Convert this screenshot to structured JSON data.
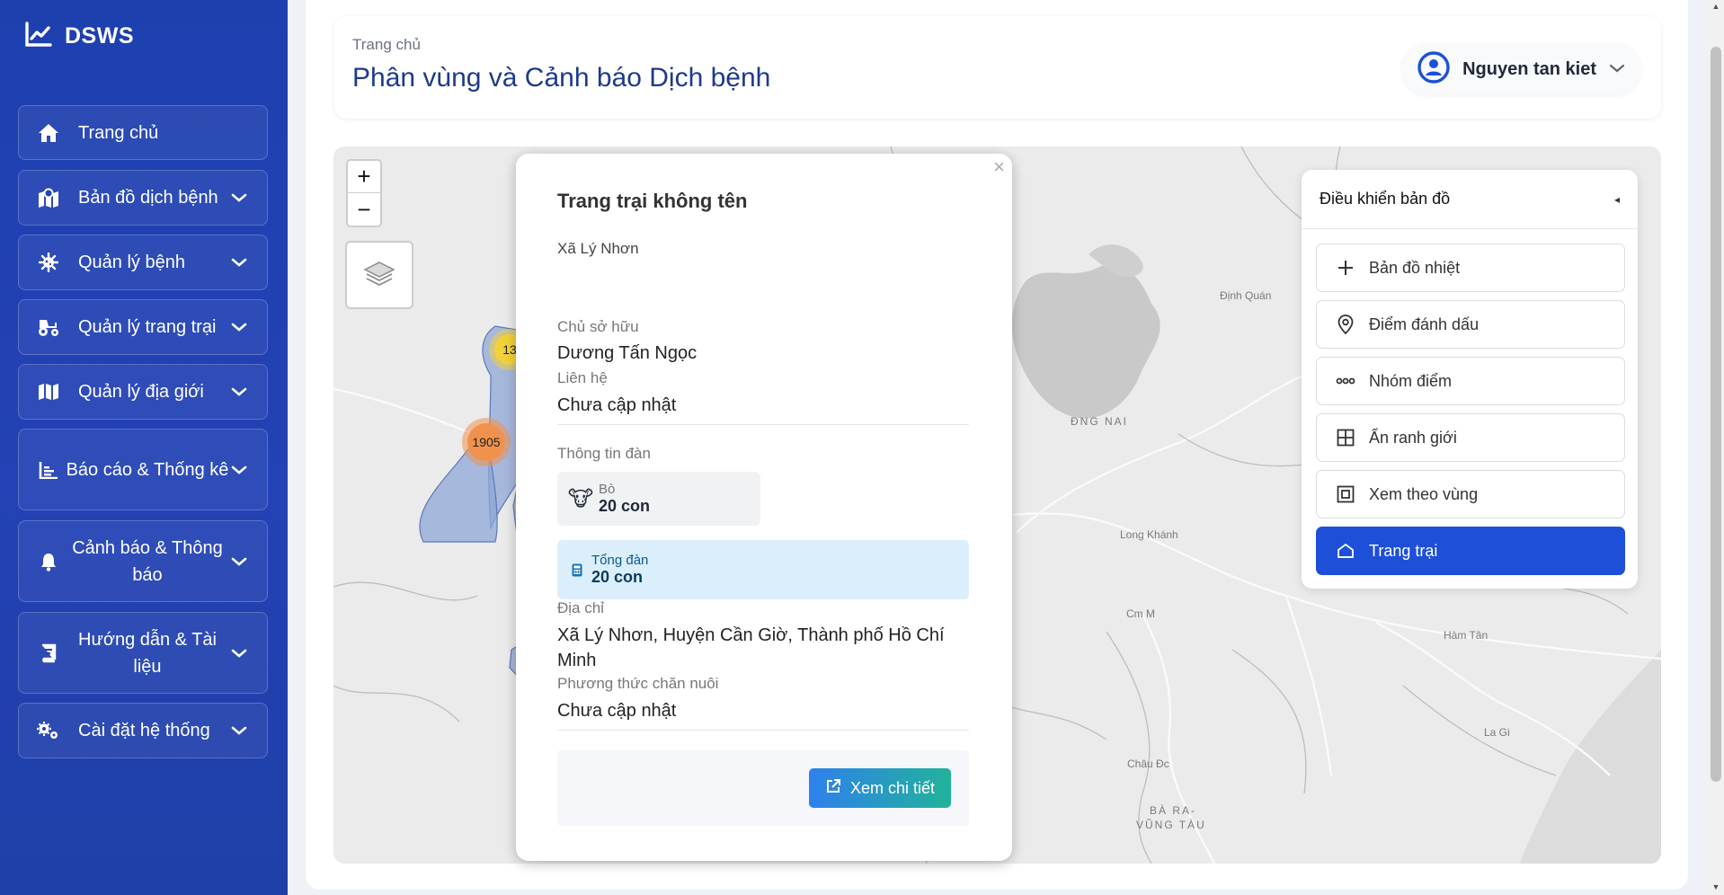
{
  "app": {
    "name": "DSWS"
  },
  "sidebar": {
    "items": [
      {
        "label": "Trang chủ",
        "icon": "home-icon"
      },
      {
        "label": "Bản đồ dịch bệnh",
        "icon": "map-marker-icon"
      },
      {
        "label": "Quản lý bệnh",
        "icon": "virus-icon"
      },
      {
        "label": "Quản lý trang trại",
        "icon": "tractor-icon"
      },
      {
        "label": "Quản lý địa giới",
        "icon": "map-icon"
      },
      {
        "label": "Báo cáo & Thống kê",
        "icon": "chart-icon"
      },
      {
        "label": "Cảnh báo & Thông báo",
        "icon": "bell-icon"
      },
      {
        "label": "Hướng dẫn & Tài liệu",
        "icon": "book-icon"
      },
      {
        "label": "Cài đặt hệ thống",
        "icon": "gears-icon"
      }
    ]
  },
  "header": {
    "breadcrumb": "Trang chủ",
    "title": "Phân vùng và Cảnh báo Dịch bệnh",
    "user_name": "Nguyen tan kiet"
  },
  "map": {
    "zoom_in": "+",
    "zoom_out": "−",
    "clusters": [
      "13",
      "1905"
    ],
    "labels": [
      "Định Quán",
      "ĐNG NAI",
      "Long Khánh",
      "Cm M",
      "Hàm Tân",
      "La Gi",
      "Châu Đc",
      "BÀ RA-",
      "VŨNG TÀU"
    ]
  },
  "popup": {
    "close": "×",
    "title": "Trang trại không tên",
    "commune": "Xã Lý Nhơn",
    "owner_label": "Chủ sở hữu",
    "owner": "Dương Tấn Ngọc",
    "contact_label": "Liên hệ",
    "contact": "Chưa cập nhật",
    "herd_label": "Thông tin đàn",
    "herd": {
      "species": "Bò",
      "count": "20 con"
    },
    "total_label": "Tổng đàn",
    "total_count": "20 con",
    "address_label": "Địa chỉ",
    "address": "Xã Lý Nhơn, Huyện Cần Giờ, Thành phố Hồ Chí Minh",
    "method_label": "Phương thức chăn nuôi",
    "method": "Chưa cập nhật",
    "detail_button": "Xem chi tiết"
  },
  "controls": {
    "title": "Điều khiển bản đồ",
    "collapse": "◂",
    "buttons": [
      {
        "label": "Bản đồ nhiệt",
        "icon": "plus-icon",
        "active": false
      },
      {
        "label": "Điểm đánh dấu",
        "icon": "location-pin-icon",
        "active": false
      },
      {
        "label": "Nhóm điểm",
        "icon": "cluster-icon",
        "active": false
      },
      {
        "label": "Ẩn ranh giới",
        "icon": "grid-icon",
        "active": false
      },
      {
        "label": "Xem theo vùng",
        "icon": "region-icon",
        "active": false
      },
      {
        "label": "Trang trại",
        "icon": "barn-icon",
        "active": true
      }
    ]
  },
  "colors": {
    "sidebar": "#1e40af",
    "accent": "#1d4fd8",
    "title": "#1e3a8a",
    "cluster_yellow": "#f2d13a",
    "cluster_orange": "#f0924e",
    "region_fill": "#8fa7d6"
  }
}
